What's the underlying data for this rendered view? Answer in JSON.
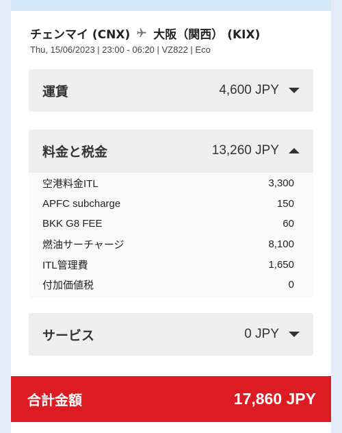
{
  "flight": {
    "origin": "チェンマイ (CNX)",
    "destination": "大阪（関西） (KIX)",
    "details": "Thu, 15/06/2023 | 23:00 - 06:20 | VZ822 | Eco"
  },
  "sections": {
    "fare": {
      "title": "運賃",
      "amount": "4,600 JPY",
      "expanded": false
    },
    "fees": {
      "title": "料金と税金",
      "amount": "13,260 JPY",
      "expanded": true,
      "items": [
        {
          "label": "空港料金ITL",
          "value": "3,300"
        },
        {
          "label": "APFC subcharge",
          "value": "150"
        },
        {
          "label": "BKK G8 FEE",
          "value": "60"
        },
        {
          "label": "燃油サーチャージ",
          "value": "8,100"
        },
        {
          "label": "ITL管理費",
          "value": "1,650"
        },
        {
          "label": "付加価値税",
          "value": "0"
        }
      ]
    },
    "services": {
      "title": "サービス",
      "amount": "0 JPY",
      "expanded": false
    }
  },
  "total": {
    "label": "合計金額",
    "amount": "17,860 JPY"
  },
  "colors": {
    "accent": "#dd1b23",
    "section_bg": "#efefef",
    "page_bg": "#e3ecf8"
  },
  "icons": {
    "route": "airplane-icon",
    "collapsed": "caret-down-icon",
    "expanded": "caret-up-icon"
  }
}
